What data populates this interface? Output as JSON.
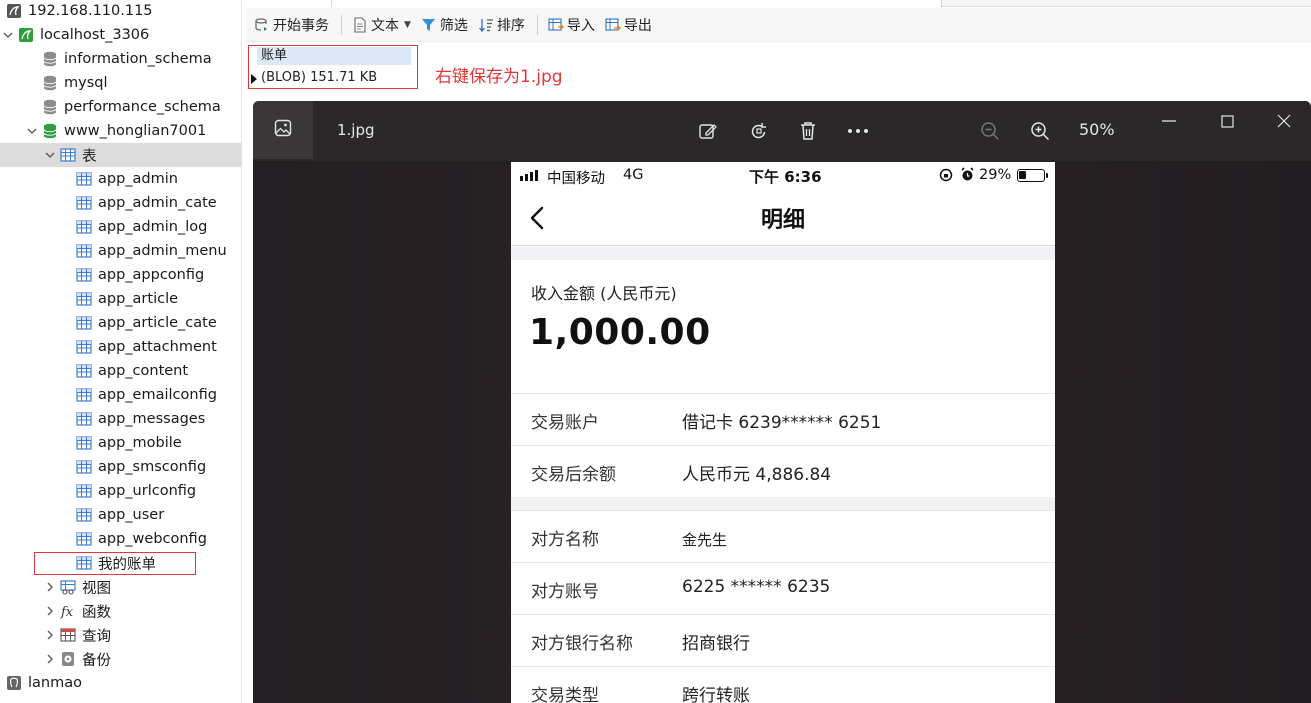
{
  "sidebar": {
    "items": [
      {
        "label": "192.168.110.115",
        "level": 0,
        "icon": "mysql-connection-icon",
        "caret": "",
        "selected": false
      },
      {
        "label": "localhost_3306",
        "level": 0,
        "icon": "mysql-connection-open-icon",
        "caret": "v",
        "selected": false
      },
      {
        "label": "information_schema",
        "level": 1,
        "icon": "database-icon",
        "caret": "",
        "selected": false
      },
      {
        "label": "mysql",
        "level": 1,
        "icon": "database-icon",
        "caret": "",
        "selected": false
      },
      {
        "label": "performance_schema",
        "level": 1,
        "icon": "database-icon",
        "caret": "",
        "selected": false
      },
      {
        "label": "www_honglian7001",
        "level": 1,
        "icon": "database-open-icon",
        "caret": "v",
        "selected": false
      },
      {
        "label": "表",
        "level": 2,
        "icon": "tables-folder-icon",
        "caret": "v",
        "selected": true
      },
      {
        "label": "app_admin",
        "level": 3,
        "icon": "table-icon",
        "caret": "",
        "selected": false
      },
      {
        "label": "app_admin_cate",
        "level": 3,
        "icon": "table-icon",
        "caret": "",
        "selected": false
      },
      {
        "label": "app_admin_log",
        "level": 3,
        "icon": "table-icon",
        "caret": "",
        "selected": false
      },
      {
        "label": "app_admin_menu",
        "level": 3,
        "icon": "table-icon",
        "caret": "",
        "selected": false
      },
      {
        "label": "app_appconfig",
        "level": 3,
        "icon": "table-icon",
        "caret": "",
        "selected": false
      },
      {
        "label": "app_article",
        "level": 3,
        "icon": "table-icon",
        "caret": "",
        "selected": false
      },
      {
        "label": "app_article_cate",
        "level": 3,
        "icon": "table-icon",
        "caret": "",
        "selected": false
      },
      {
        "label": "app_attachment",
        "level": 3,
        "icon": "table-icon",
        "caret": "",
        "selected": false
      },
      {
        "label": "app_content",
        "level": 3,
        "icon": "table-icon",
        "caret": "",
        "selected": false
      },
      {
        "label": "app_emailconfig",
        "level": 3,
        "icon": "table-icon",
        "caret": "",
        "selected": false
      },
      {
        "label": "app_messages",
        "level": 3,
        "icon": "table-icon",
        "caret": "",
        "selected": false
      },
      {
        "label": "app_mobile",
        "level": 3,
        "icon": "table-icon",
        "caret": "",
        "selected": false
      },
      {
        "label": "app_smsconfig",
        "level": 3,
        "icon": "table-icon",
        "caret": "",
        "selected": false
      },
      {
        "label": "app_urlconfig",
        "level": 3,
        "icon": "table-icon",
        "caret": "",
        "selected": false
      },
      {
        "label": "app_user",
        "level": 3,
        "icon": "table-icon",
        "caret": "",
        "selected": false
      },
      {
        "label": "app_webconfig",
        "level": 3,
        "icon": "table-icon",
        "caret": "",
        "selected": false
      },
      {
        "label": "我的账单",
        "level": 3,
        "icon": "table-icon",
        "caret": "",
        "selected": false
      },
      {
        "label": "视图",
        "level": 2,
        "icon": "views-folder-icon",
        "caret": ">",
        "selected": false
      },
      {
        "label": "函数",
        "level": 2,
        "icon": "function-icon",
        "caret": ">",
        "selected": false
      },
      {
        "label": "查询",
        "level": 2,
        "icon": "query-icon",
        "caret": ">",
        "selected": false
      },
      {
        "label": "备份",
        "level": 2,
        "icon": "backup-icon",
        "caret": ">",
        "selected": false
      },
      {
        "label": "lanmao",
        "level": 0,
        "icon": "postgres-connection-icon",
        "caret": "",
        "selected": false
      }
    ]
  },
  "toolbar": {
    "begin_transaction": "开始事务",
    "text": "文本",
    "filter": "筛选",
    "sort": "排序",
    "import": "导入",
    "export": "导出"
  },
  "grid": {
    "column_header": "账单",
    "cell_value": "(BLOB) 151.71 KB"
  },
  "annotation": "右键保存为1.jpg",
  "viewer": {
    "file_name": "1.jpg",
    "zoom": "50%"
  },
  "phone": {
    "carrier": "中国移动",
    "network": "4G",
    "time": "下午 6:36",
    "battery_text": "29%",
    "battery_level": 0.29,
    "title": "明细",
    "amount_label": "收入金额 (人民币元)",
    "amount": "1,000.00",
    "rows": [
      {
        "key": "交易账户",
        "value": "借记卡 6239****** 6251"
      },
      {
        "key": "交易后余额",
        "value": "人民币元 4,886.84"
      },
      {
        "key": "对方名称",
        "value": "金先生"
      },
      {
        "key": "对方账号",
        "value": "6225 ****** 6235"
      },
      {
        "key": "对方银行名称",
        "value": "招商银行"
      },
      {
        "key": "交易类型",
        "value": "跨行转账"
      }
    ]
  },
  "colors": {
    "highlight_red": "#e0383a",
    "selected_row": "#dcdcdc",
    "viewer_bg": "#232022"
  }
}
